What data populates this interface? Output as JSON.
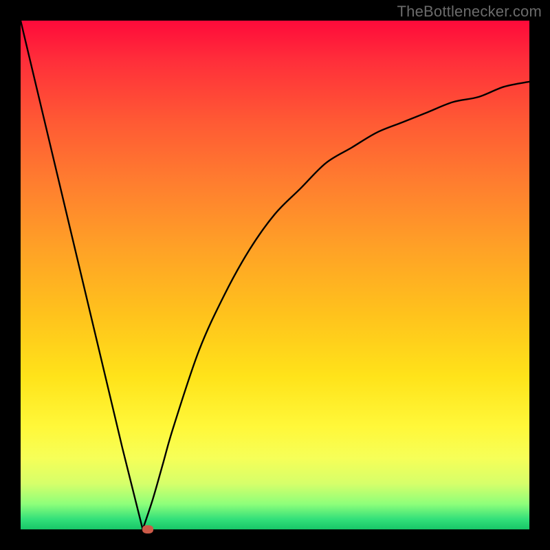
{
  "watermark": "TheBottlenecker.com",
  "colors": {
    "frame": "#000000",
    "curve": "#000000",
    "marker": "#cc5a48",
    "gradient_top": "#ff0a3a",
    "gradient_bottom": "#17c667"
  },
  "chart_data": {
    "type": "line",
    "title": "",
    "xlabel": "",
    "ylabel": "",
    "xlim": [
      0,
      100
    ],
    "ylim": [
      0,
      100
    ],
    "grid": false,
    "curve": {
      "description": "V-shaped bottleneck curve: steep linear descent from top-left to a minimum near x≈24, then smooth asymptotic rise toward the right.",
      "x": [
        0,
        5,
        10,
        15,
        20,
        22,
        24,
        26,
        28,
        30,
        35,
        40,
        45,
        50,
        55,
        60,
        65,
        70,
        75,
        80,
        85,
        90,
        95,
        100
      ],
      "y": [
        100,
        79,
        58,
        37,
        16,
        8,
        0,
        6,
        13,
        20,
        35,
        46,
        55,
        62,
        67,
        72,
        75,
        78,
        80,
        82,
        84,
        85,
        87,
        88
      ]
    },
    "marker": {
      "x": 25,
      "y": 0
    },
    "annotations": [
      {
        "text": "TheBottlenecker.com",
        "role": "watermark",
        "position": "top-right"
      }
    ]
  }
}
